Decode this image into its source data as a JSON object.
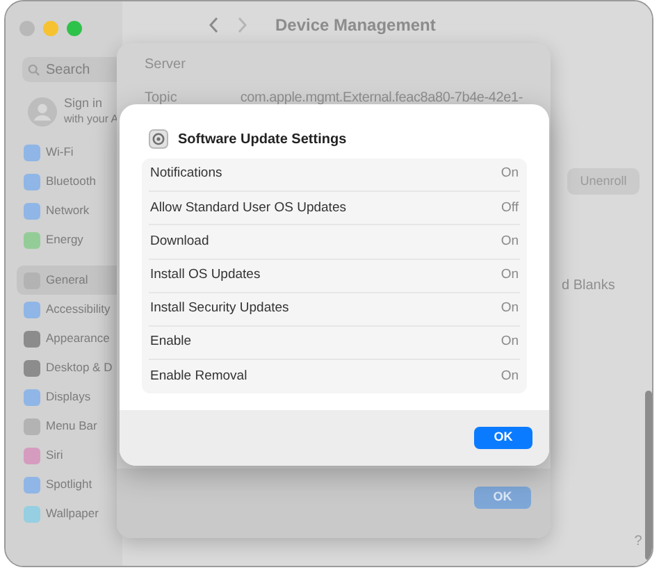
{
  "window": {
    "title": "Device Management"
  },
  "sidebar": {
    "search": {
      "placeholder": "Search"
    },
    "account": {
      "title": "Sign in",
      "subtitle": "with your A"
    },
    "items": [
      {
        "label": "Wi-Fi",
        "color": "#8fb6e6",
        "selected": false
      },
      {
        "label": "Bluetooth",
        "color": "#8fb6e6",
        "selected": false
      },
      {
        "label": "Network",
        "color": "#8fb6e6",
        "selected": false
      },
      {
        "label": "Energy",
        "color": "#94cc98",
        "selected": false
      },
      {
        "label": "General",
        "color": "#b3b3b3",
        "selected": true
      },
      {
        "label": "Accessibility",
        "color": "#8fb6e6",
        "selected": false
      },
      {
        "label": "Appearance",
        "color": "#8c8c8c",
        "selected": false
      },
      {
        "label": "Desktop & D",
        "color": "#8c8c8c",
        "selected": false
      },
      {
        "label": "Displays",
        "color": "#8fb6e6",
        "selected": false
      },
      {
        "label": "Menu Bar",
        "color": "#b3b3b3",
        "selected": false
      },
      {
        "label": "Siri",
        "color": "#d69cc0",
        "selected": false
      },
      {
        "label": "Spotlight",
        "color": "#8fb6e6",
        "selected": false
      },
      {
        "label": "Wallpaper",
        "color": "#96cfe2",
        "selected": false
      }
    ]
  },
  "main": {
    "unenroll_button": "Unenroll",
    "partial_text": "d Blanks",
    "help": "?"
  },
  "sheet": {
    "rows": [
      {
        "label": "Server",
        "value": ""
      },
      {
        "label": "Topic",
        "value": "com.apple.mgmt.External.feac8a80-7b4e-42e1-"
      }
    ],
    "ok_button": "OK"
  },
  "dialog": {
    "title": "Software Update Settings",
    "rows": [
      {
        "label": "Notifications",
        "value": "On"
      },
      {
        "label": "Allow Standard User OS Updates",
        "value": "Off"
      },
      {
        "label": "Download",
        "value": "On"
      },
      {
        "label": "Install OS Updates",
        "value": "On"
      },
      {
        "label": "Install Security Updates",
        "value": "On"
      },
      {
        "label": "Enable",
        "value": "On"
      },
      {
        "label": "Enable Removal",
        "value": "On"
      }
    ],
    "ok_button": "OK"
  }
}
